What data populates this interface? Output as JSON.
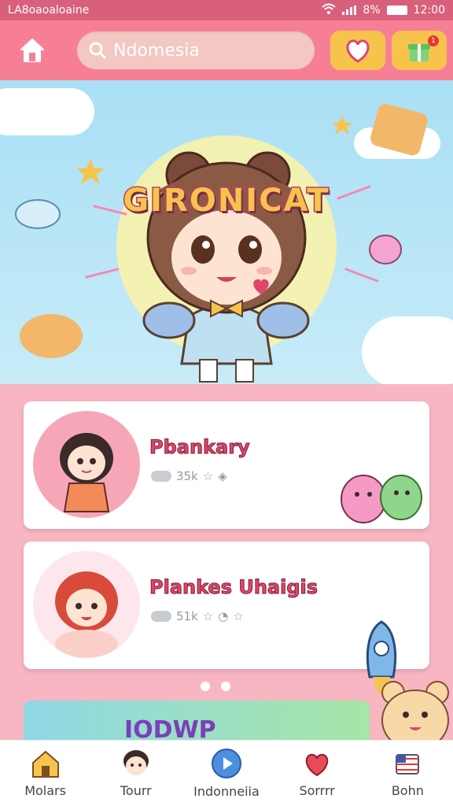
{
  "status_bar": {
    "carrier": "LA8oaoaloaine",
    "battery_text": "8%",
    "time": "12:00"
  },
  "header": {
    "search_value": "Ndomesia",
    "notification_count": "1"
  },
  "hero": {
    "title": "GIRONICAT"
  },
  "cards": [
    {
      "name": "Pbankary",
      "stat": "35k"
    },
    {
      "name": "Plankes Uhaigis",
      "stat": "51k"
    }
  ],
  "promo": {
    "text": "IODWP"
  },
  "bottom_nav": [
    {
      "label": "Molars"
    },
    {
      "label": "Tourr"
    },
    {
      "label": "Indonneiia"
    },
    {
      "label": "Sorrrr"
    },
    {
      "label": "Bohn"
    }
  ],
  "colors": {
    "header": "#f77f95",
    "accent": "#f6c44c",
    "page": "#f8b6c3",
    "title": "#e0466b"
  }
}
